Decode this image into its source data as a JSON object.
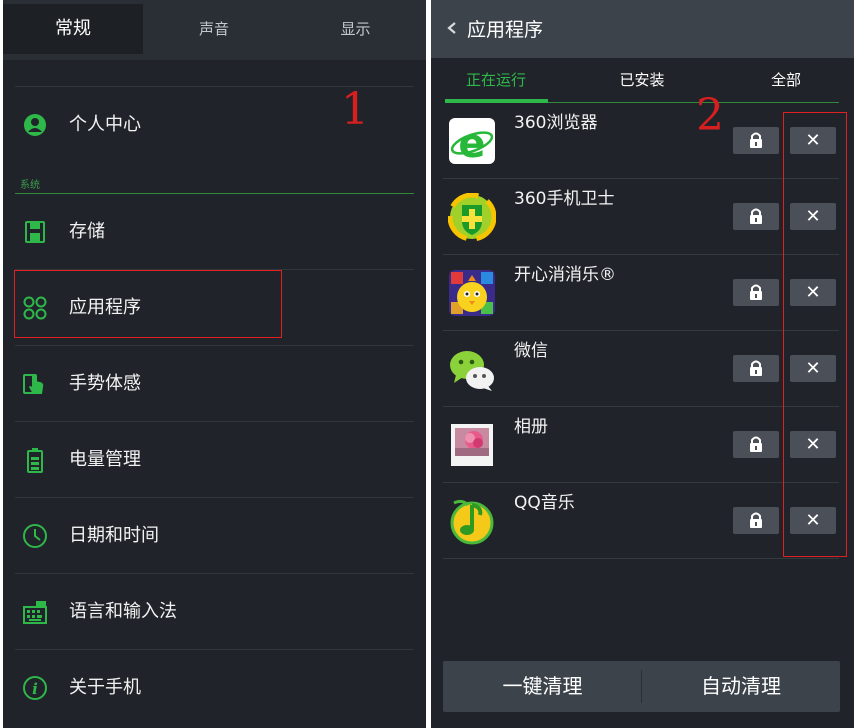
{
  "settings": {
    "tabs": [
      {
        "label": "常规",
        "active": true
      },
      {
        "label": "声音",
        "active": false
      },
      {
        "label": "显示",
        "active": false
      }
    ],
    "section_label": "系统",
    "items": [
      {
        "label": "个人中心",
        "icon": "person-icon"
      },
      {
        "label": "存储",
        "icon": "storage-icon"
      },
      {
        "label": "应用程序",
        "icon": "apps-icon"
      },
      {
        "label": "手势体感",
        "icon": "gesture-icon"
      },
      {
        "label": "电量管理",
        "icon": "battery-icon"
      },
      {
        "label": "日期和时间",
        "icon": "clock-icon"
      },
      {
        "label": "语言和输入法",
        "icon": "keyboard-icon"
      },
      {
        "label": "关于手机",
        "icon": "info-icon"
      }
    ],
    "annotation_number": "1"
  },
  "apps_screen": {
    "title": "应用程序",
    "subtabs": [
      {
        "label": "正在运行",
        "active": true
      },
      {
        "label": "已安装",
        "active": false
      },
      {
        "label": "全部",
        "active": false
      }
    ],
    "apps": [
      {
        "name": "360浏览器",
        "icon": "360-browser-icon"
      },
      {
        "name": "360手机卫士",
        "icon": "360-security-icon"
      },
      {
        "name": "开心消消乐®",
        "icon": "happy-elimination-icon"
      },
      {
        "name": "微信",
        "icon": "wechat-icon"
      },
      {
        "name": "相册",
        "icon": "gallery-icon"
      },
      {
        "name": "QQ音乐",
        "icon": "qq-music-icon"
      }
    ],
    "close_symbol": "✕",
    "one_key_clean": "一键清理",
    "auto_clean": "自动清理",
    "annotation_number": "2"
  },
  "colors": {
    "background": "#20242a",
    "accent_green": "#2fb84a",
    "annotation_red": "#e02020"
  }
}
